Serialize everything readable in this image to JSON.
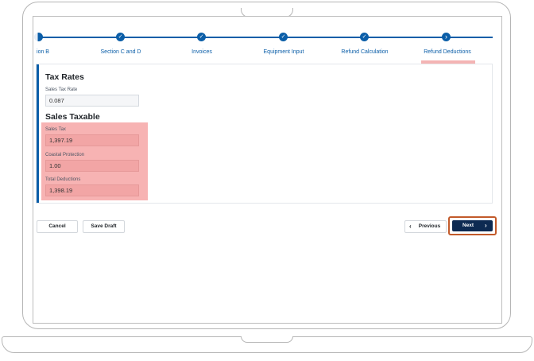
{
  "stepper": {
    "steps": [
      {
        "label": "ion B"
      },
      {
        "label": "Section C and D"
      },
      {
        "label": "Invoices"
      },
      {
        "label": "Equipment Input"
      },
      {
        "label": "Refund Calculation"
      },
      {
        "label": "Refund Deductions"
      }
    ],
    "check_glyph": "✓",
    "current_glyph": "›"
  },
  "tax_rates": {
    "title": "Tax Rates",
    "sales_tax_rate_label": "Sales Tax Rate",
    "sales_tax_rate_value": "0.087"
  },
  "sales_taxable": {
    "title": "Sales Taxable",
    "sales_tax_label": "Sales Tax",
    "sales_tax_value": "1,397.19",
    "coastal_label": "Coastal Protection",
    "coastal_value": "1.00",
    "total_label": "Total Deductions",
    "total_value": "1,398.19"
  },
  "footer": {
    "cancel_label": "Cancel",
    "save_draft_label": "Save Draft",
    "previous_label": "Previous",
    "next_label": "Next",
    "prev_chevron": "‹",
    "next_chevron": "›"
  },
  "colors": {
    "accent": "#0b5ea8",
    "next_button": "#0d2a52",
    "highlight": "#f7b3b3",
    "focus_ring": "#c25a2a"
  }
}
